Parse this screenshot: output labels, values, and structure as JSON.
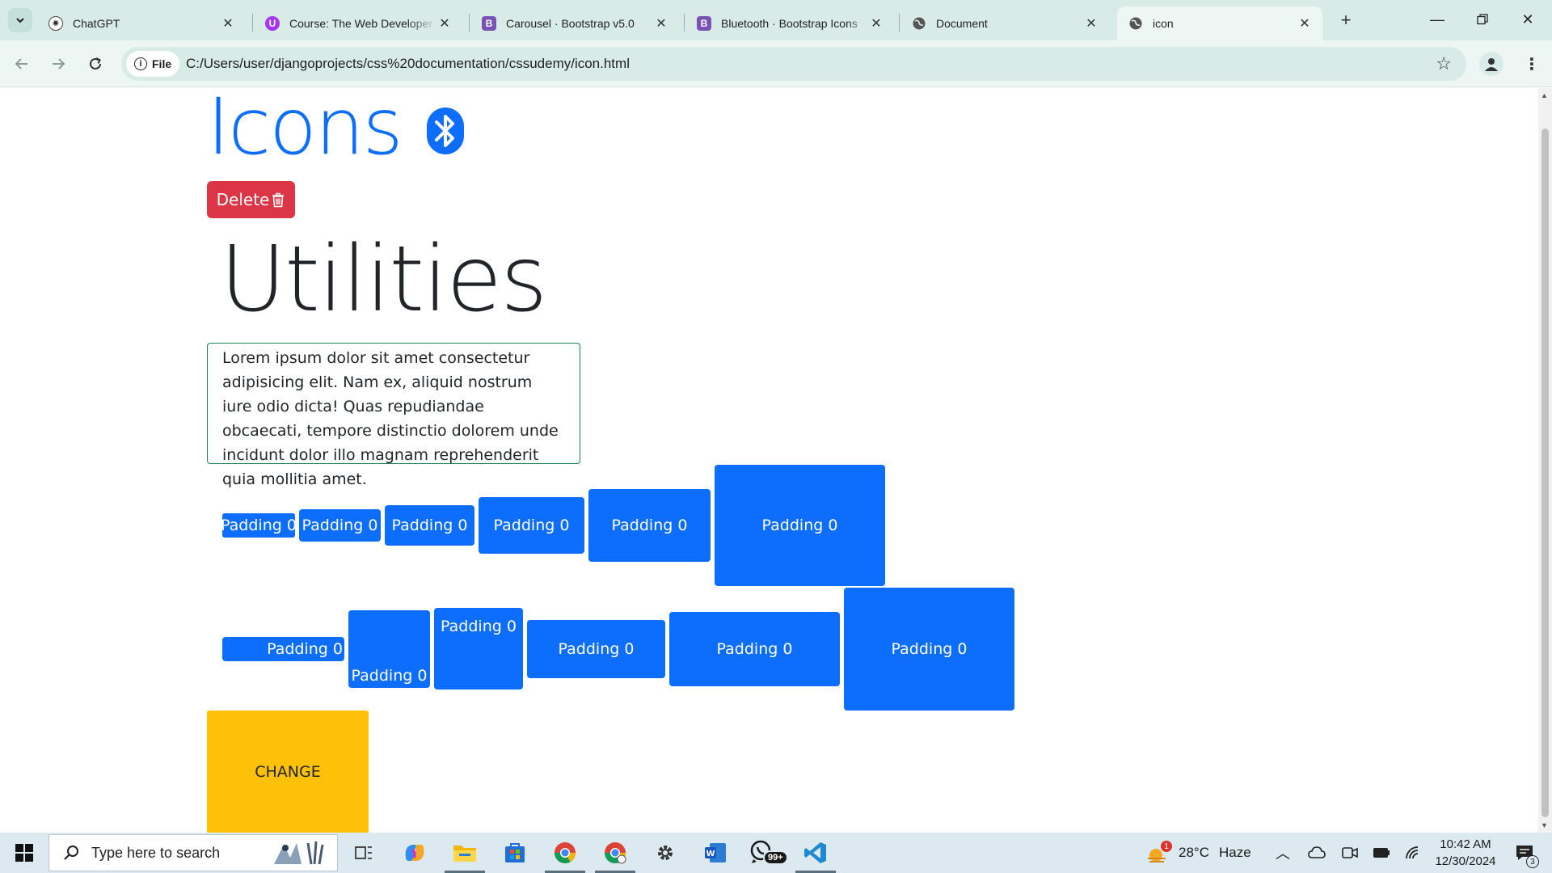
{
  "browser": {
    "tabs": [
      {
        "title": "ChatGPT",
        "favicon": "chatgpt-icon",
        "active": false
      },
      {
        "title": "Course: The Web Developer Bootcamp",
        "favicon": "udemy-icon",
        "active": false
      },
      {
        "title": "Carousel · Bootstrap v5.0",
        "favicon": "bootstrap-icon",
        "active": false
      },
      {
        "title": "Bluetooth · Bootstrap Icons",
        "favicon": "bootstrap-icon",
        "active": false
      },
      {
        "title": "Document",
        "favicon": "globe-icon",
        "active": false
      },
      {
        "title": "icon",
        "favicon": "globe-icon",
        "active": true
      }
    ],
    "address": {
      "chip_label": "File",
      "url": "C:/Users/user/djangoprojects/css%20documentation/cssudemy/icon.html"
    },
    "colors": {
      "tabstrip": "#d8ebe6",
      "toolbar": "#eef6f3"
    }
  },
  "page": {
    "icons_heading": "Icons",
    "delete_label": "Delete",
    "utilities_heading": "Utilities",
    "lorem_text": "Lorem ipsum dolor sit amet consectetur adipisicing elit. Nam ex, aliquid nostrum iure odio dicta! Quas repudiandae obcaecati, tempore distinctio dolorem unde incidunt dolor illo magnam reprehenderit quia mollitia amet.",
    "padding_row_1": [
      "Padding 0",
      "Padding 0",
      "Padding 0",
      "Padding 0",
      "Padding 0",
      "Padding 0"
    ],
    "padding_row_2": [
      "Padding 0",
      "Padding 0",
      "Padding 0",
      "Padding 0",
      "Padding 0",
      "Padding 0"
    ],
    "change_label": "CHANGE",
    "colors": {
      "primary": "#0d6efd",
      "danger": "#dc3545",
      "warning": "#ffc107",
      "success_border": "#198754"
    }
  },
  "taskbar": {
    "search_placeholder": "Type here to search",
    "weather": {
      "temp": "28°C",
      "condition": "Haze",
      "alert_count": "1"
    },
    "whatsapp_badge": "99+",
    "clock": {
      "time": "10:42 AM",
      "date": "12/30/2024"
    },
    "notification_count": "3"
  }
}
